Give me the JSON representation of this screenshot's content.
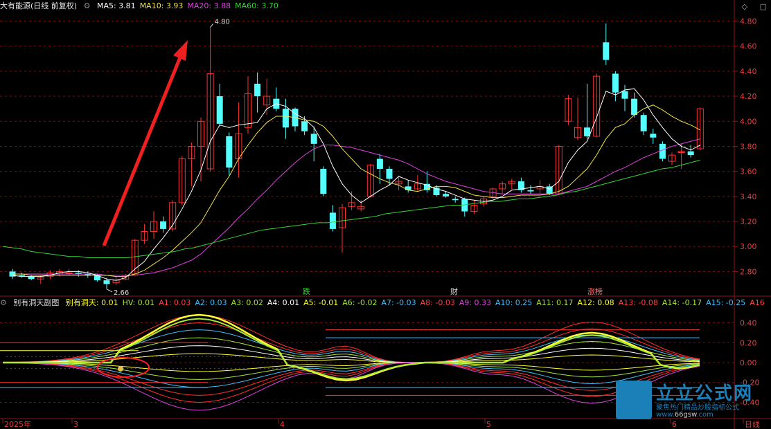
{
  "header": {
    "ticker": "大有能源(日线 前复权)",
    "ma": [
      {
        "label": "MA5: 3.81",
        "color": "#ffffff"
      },
      {
        "label": "MA10: 3.93",
        "color": "#f0e34a"
      },
      {
        "label": "MA20: 3.88",
        "color": "#e040e0"
      },
      {
        "label": "MA60: 3.70",
        "color": "#35d335"
      }
    ]
  },
  "sub_header": {
    "title": "别有洞天副图",
    "items": [
      {
        "label": "别有洞天: 0.01",
        "color": "#ffff33"
      },
      {
        "label": "HV: 0.01",
        "color": "#a6e838"
      },
      {
        "label": "A1: 0.03",
        "color": "#ff4040"
      },
      {
        "label": "A2: 0.03",
        "color": "#40c0ff"
      },
      {
        "label": "A3: 0.02",
        "color": "#a6e838"
      },
      {
        "label": "A4: 0.01",
        "color": "#ffffff"
      },
      {
        "label": "A5: -0.01",
        "color": "#ffff33"
      },
      {
        "label": "A6: -0.02",
        "color": "#a6e838"
      },
      {
        "label": "A7: -0.03",
        "color": "#40c0ff"
      },
      {
        "label": "A8: -0.03",
        "color": "#ff4040"
      },
      {
        "label": "A9: 0.33",
        "color": "#e040e0"
      },
      {
        "label": "A10: 0.25",
        "color": "#40c0ff"
      },
      {
        "label": "A11: 0.17",
        "color": "#a6e838"
      },
      {
        "label": "A12: 0.08",
        "color": "#ffff33"
      },
      {
        "label": "A13: -0.08",
        "color": "#ff4040"
      },
      {
        "label": "A14: -0.17",
        "color": "#a6e838"
      },
      {
        "label": "A15: -0.25",
        "color": "#40c0ff"
      },
      {
        "label": "A16",
        "color": "#ff4040"
      }
    ]
  },
  "annotations": {
    "high": "4.80",
    "low": "2.66",
    "tag1": "跌",
    "tag2": "财",
    "tag3": "涨榜"
  },
  "x_axis": {
    "labels": [
      "2025年",
      "3",
      "4",
      "5",
      "6",
      "日线"
    ]
  },
  "watermark": {
    "brand": "立立公式网",
    "slogan": "聚焦热门精品炒股指标公式",
    "url_prefix": "www.",
    "url_main": "66gsw",
    "url_suffix": ".com"
  },
  "chart_data": [
    {
      "type": "candlestick",
      "title": "大有能源(日线 前复权)",
      "yticks": [
        2.8,
        3.0,
        3.2,
        3.4,
        3.6,
        3.8,
        4.0,
        4.2,
        4.4,
        4.6,
        4.8
      ],
      "ylim": [
        2.62,
        4.88
      ],
      "grid": true,
      "candles": [
        [
          2.8,
          2.76,
          2.82,
          2.74
        ],
        [
          2.77,
          2.76,
          2.79,
          2.75
        ],
        [
          2.76,
          2.74,
          2.77,
          2.73
        ],
        [
          2.74,
          2.75,
          2.77,
          2.7
        ],
        [
          2.76,
          2.79,
          2.81,
          2.74
        ],
        [
          2.78,
          2.8,
          2.82,
          2.76
        ],
        [
          2.79,
          2.79,
          2.82,
          2.77
        ],
        [
          2.79,
          2.78,
          2.81,
          2.76
        ],
        [
          2.78,
          2.77,
          2.8,
          2.75
        ],
        [
          2.77,
          2.73,
          2.78,
          2.72
        ],
        [
          2.73,
          2.7,
          2.75,
          2.66
        ],
        [
          2.71,
          2.73,
          2.76,
          2.69
        ],
        [
          2.74,
          2.77,
          2.78,
          2.73
        ],
        [
          2.78,
          3.05,
          3.06,
          2.77
        ],
        [
          3.05,
          3.12,
          3.18,
          3.02
        ],
        [
          3.12,
          3.2,
          3.28,
          3.06
        ],
        [
          3.2,
          3.14,
          3.24,
          3.11
        ],
        [
          3.14,
          3.35,
          3.37,
          3.12
        ],
        [
          3.35,
          3.7,
          3.72,
          3.33
        ],
        [
          3.7,
          3.8,
          3.83,
          3.48
        ],
        [
          3.8,
          4.0,
          4.03,
          3.52
        ],
        [
          3.62,
          4.38,
          4.75,
          3.6
        ],
        [
          4.2,
          3.98,
          4.3,
          3.96
        ],
        [
          3.88,
          3.63,
          3.91,
          3.57
        ],
        [
          3.7,
          3.9,
          4.15,
          3.55
        ],
        [
          3.95,
          4.22,
          4.36,
          3.9
        ],
        [
          4.3,
          4.2,
          4.39,
          4.07
        ],
        [
          4.13,
          4.2,
          4.34,
          4.05
        ],
        [
          4.18,
          4.1,
          4.27,
          4.08
        ],
        [
          4.1,
          3.95,
          4.18,
          3.86
        ],
        [
          4.1,
          3.96,
          4.11,
          3.92
        ],
        [
          4.0,
          3.92,
          4.04,
          3.89
        ],
        [
          3.9,
          3.82,
          3.96,
          3.68
        ],
        [
          3.62,
          3.42,
          3.64,
          3.4
        ],
        [
          3.27,
          3.14,
          3.33,
          3.12
        ],
        [
          3.15,
          3.31,
          3.34,
          2.95
        ],
        [
          3.32,
          3.35,
          3.44,
          3.29
        ],
        [
          3.3,
          3.32,
          3.37,
          3.28
        ],
        [
          3.4,
          3.65,
          3.66,
          3.39
        ],
        [
          3.7,
          3.62,
          3.74,
          3.5
        ],
        [
          3.62,
          3.54,
          3.64,
          3.49
        ],
        [
          3.5,
          3.52,
          3.56,
          3.45
        ],
        [
          3.48,
          3.45,
          3.53,
          3.43
        ],
        [
          3.46,
          3.5,
          3.57,
          3.44
        ],
        [
          3.5,
          3.45,
          3.6,
          3.43
        ],
        [
          3.47,
          3.41,
          3.49,
          3.4
        ],
        [
          3.42,
          3.4,
          3.44,
          3.39
        ],
        [
          3.38,
          3.37,
          3.4,
          3.35
        ],
        [
          3.38,
          3.28,
          3.39,
          3.24
        ],
        [
          3.28,
          3.33,
          3.37,
          3.26
        ],
        [
          3.34,
          3.38,
          3.4,
          3.32
        ],
        [
          3.4,
          3.46,
          3.47,
          3.38
        ],
        [
          3.46,
          3.5,
          3.52,
          3.42
        ],
        [
          3.5,
          3.52,
          3.54,
          3.46
        ],
        [
          3.52,
          3.45,
          3.55,
          3.43
        ],
        [
          3.45,
          3.44,
          3.49,
          3.42
        ],
        [
          3.46,
          3.48,
          3.53,
          3.42
        ],
        [
          3.48,
          3.42,
          3.5,
          3.41
        ],
        [
          3.42,
          3.8,
          3.81,
          3.41
        ],
        [
          4.0,
          4.18,
          4.21,
          3.97
        ],
        [
          3.87,
          3.95,
          4.19,
          3.85
        ],
        [
          3.95,
          3.88,
          4.3,
          3.86
        ],
        [
          3.88,
          4.36,
          4.38,
          3.87
        ],
        [
          4.63,
          4.49,
          4.78,
          4.45
        ],
        [
          4.38,
          4.23,
          4.4,
          4.16
        ],
        [
          4.24,
          4.18,
          4.29,
          4.08
        ],
        [
          4.18,
          4.05,
          4.23,
          4.03
        ],
        [
          4.05,
          3.92,
          4.07,
          3.89
        ],
        [
          3.9,
          3.87,
          3.94,
          3.82
        ],
        [
          3.82,
          3.7,
          3.84,
          3.68
        ],
        [
          3.68,
          3.73,
          3.75,
          3.65
        ],
        [
          3.75,
          3.76,
          3.82,
          3.62
        ],
        [
          3.76,
          3.73,
          3.81,
          3.71
        ],
        [
          3.78,
          4.1,
          4.11,
          3.77
        ]
      ],
      "ma5": [
        2.77,
        2.76,
        2.76,
        2.76,
        2.77,
        2.79,
        2.8,
        2.8,
        2.79,
        2.77,
        2.74,
        2.73,
        2.75,
        2.82,
        2.88,
        2.98,
        3.07,
        3.17,
        3.3,
        3.44,
        3.61,
        3.84,
        3.97,
        3.95,
        3.97,
        3.98,
        3.99,
        4.1,
        4.14,
        4.12,
        4.06,
        4.02,
        3.95,
        3.82,
        3.64,
        3.5,
        3.41,
        3.35,
        3.4,
        3.45,
        3.49,
        3.56,
        3.53,
        3.51,
        3.49,
        3.46,
        3.44,
        3.41,
        3.38,
        3.37,
        3.36,
        3.37,
        3.4,
        3.45,
        3.46,
        3.47,
        3.48,
        3.46,
        3.52,
        3.67,
        3.77,
        3.84,
        4.03,
        4.24,
        4.21,
        4.25,
        4.26,
        4.17,
        4.05,
        3.95,
        3.86,
        3.8,
        3.77,
        3.81
      ],
      "ma10": [
        2.78,
        2.78,
        2.77,
        2.77,
        2.77,
        2.77,
        2.77,
        2.77,
        2.77,
        2.77,
        2.77,
        2.76,
        2.76,
        2.78,
        2.81,
        2.86,
        2.91,
        2.97,
        3.04,
        3.11,
        3.19,
        3.32,
        3.45,
        3.56,
        3.7,
        3.81,
        3.91,
        3.99,
        4.04,
        4.04,
        4.03,
        4.01,
        4.0,
        3.96,
        3.88,
        3.78,
        3.7,
        3.62,
        3.58,
        3.54,
        3.51,
        3.49,
        3.45,
        3.44,
        3.46,
        3.48,
        3.48,
        3.47,
        3.44,
        3.41,
        3.4,
        3.39,
        3.39,
        3.4,
        3.41,
        3.41,
        3.41,
        3.42,
        3.44,
        3.48,
        3.55,
        3.62,
        3.73,
        3.86,
        3.95,
        3.98,
        4.05,
        4.1,
        4.13,
        4.09,
        4.04,
        4.0,
        3.97,
        3.93
      ],
      "ma20": [
        2.78,
        2.78,
        2.78,
        2.78,
        2.78,
        2.78,
        2.78,
        2.78,
        2.78,
        2.78,
        2.77,
        2.77,
        2.77,
        2.77,
        2.78,
        2.79,
        2.81,
        2.83,
        2.86,
        2.89,
        2.94,
        3.01,
        3.08,
        3.15,
        3.23,
        3.3,
        3.38,
        3.45,
        3.53,
        3.6,
        3.67,
        3.73,
        3.78,
        3.81,
        3.81,
        3.8,
        3.79,
        3.77,
        3.75,
        3.73,
        3.71,
        3.69,
        3.66,
        3.62,
        3.58,
        3.55,
        3.52,
        3.5,
        3.48,
        3.46,
        3.44,
        3.43,
        3.42,
        3.42,
        3.42,
        3.42,
        3.42,
        3.42,
        3.42,
        3.44,
        3.46,
        3.48,
        3.52,
        3.56,
        3.6,
        3.63,
        3.67,
        3.71,
        3.74,
        3.77,
        3.8,
        3.82,
        3.84,
        3.86
      ]
    },
    {
      "type": "line",
      "title": "别有洞天副图",
      "yticks": [
        -0.4,
        -0.2,
        0.0,
        0.2,
        0.4
      ],
      "ylim": [
        -0.55,
        0.55
      ]
    }
  ]
}
